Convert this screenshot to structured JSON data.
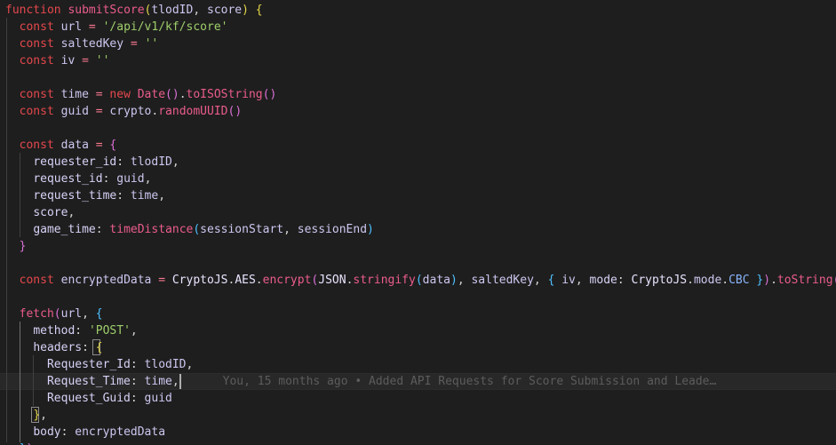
{
  "editor": {
    "blame_text": "You, 15 months ago • Added API Requests for Score Submission and Leade…",
    "lines": [
      [
        [
          "kw",
          "function "
        ],
        [
          "fn",
          "submitScore"
        ],
        [
          "b1",
          "("
        ],
        [
          "var",
          "tlodID"
        ],
        [
          "p",
          ", "
        ],
        [
          "var",
          "score"
        ],
        [
          "b1",
          ")"
        ],
        [
          "p",
          " "
        ],
        [
          "b1",
          "{"
        ]
      ],
      [
        [
          "p",
          "  "
        ],
        [
          "kw",
          "const "
        ],
        [
          "var",
          "url"
        ],
        [
          "op",
          " = "
        ],
        [
          "str",
          "'/api/v1/kf/score'"
        ]
      ],
      [
        [
          "p",
          "  "
        ],
        [
          "kw",
          "const "
        ],
        [
          "var",
          "saltedKey"
        ],
        [
          "op",
          " = "
        ],
        [
          "str",
          "''"
        ]
      ],
      [
        [
          "p",
          "  "
        ],
        [
          "kw",
          "const "
        ],
        [
          "var",
          "iv"
        ],
        [
          "op",
          " = "
        ],
        [
          "str",
          "''"
        ]
      ],
      [],
      [
        [
          "p",
          "  "
        ],
        [
          "kw",
          "const "
        ],
        [
          "var",
          "time"
        ],
        [
          "op",
          " = "
        ],
        [
          "kw",
          "new "
        ],
        [
          "fn",
          "Date"
        ],
        [
          "b2",
          "()"
        ],
        [
          "p",
          "."
        ],
        [
          "fn",
          "toISOString"
        ],
        [
          "b2",
          "()"
        ]
      ],
      [
        [
          "p",
          "  "
        ],
        [
          "kw",
          "const "
        ],
        [
          "var",
          "guid"
        ],
        [
          "op",
          " = "
        ],
        [
          "var",
          "crypto"
        ],
        [
          "p",
          "."
        ],
        [
          "fn",
          "randomUUID"
        ],
        [
          "b2",
          "()"
        ]
      ],
      [],
      [
        [
          "p",
          "  "
        ],
        [
          "kw",
          "const "
        ],
        [
          "var",
          "data"
        ],
        [
          "op",
          " = "
        ],
        [
          "b2",
          "{"
        ]
      ],
      [
        [
          "p",
          "    "
        ],
        [
          "prop",
          "requester_id"
        ],
        [
          "p",
          ": "
        ],
        [
          "var",
          "tlodID"
        ],
        [
          "p",
          ","
        ]
      ],
      [
        [
          "p",
          "    "
        ],
        [
          "prop",
          "request_id"
        ],
        [
          "p",
          ": "
        ],
        [
          "var",
          "guid"
        ],
        [
          "p",
          ","
        ]
      ],
      [
        [
          "p",
          "    "
        ],
        [
          "prop",
          "request_time"
        ],
        [
          "p",
          ": "
        ],
        [
          "var",
          "time"
        ],
        [
          "p",
          ","
        ]
      ],
      [
        [
          "p",
          "    "
        ],
        [
          "prop",
          "score"
        ],
        [
          "p",
          ","
        ]
      ],
      [
        [
          "p",
          "    "
        ],
        [
          "prop",
          "game_time"
        ],
        [
          "p",
          ": "
        ],
        [
          "fn",
          "timeDistance"
        ],
        [
          "b3",
          "("
        ],
        [
          "var",
          "sessionStart"
        ],
        [
          "p",
          ", "
        ],
        [
          "var",
          "sessionEnd"
        ],
        [
          "b3",
          ")"
        ]
      ],
      [
        [
          "p",
          "  "
        ],
        [
          "b2",
          "}"
        ]
      ],
      [],
      [
        [
          "p",
          "  "
        ],
        [
          "kw",
          "const "
        ],
        [
          "var",
          "encryptedData"
        ],
        [
          "op",
          " = "
        ],
        [
          "cls",
          "CryptoJS"
        ],
        [
          "p",
          "."
        ],
        [
          "cls",
          "AES"
        ],
        [
          "p",
          "."
        ],
        [
          "fn",
          "encrypt"
        ],
        [
          "b2",
          "("
        ],
        [
          "cls",
          "JSON"
        ],
        [
          "p",
          "."
        ],
        [
          "fn",
          "stringify"
        ],
        [
          "b3",
          "("
        ],
        [
          "var",
          "data"
        ],
        [
          "b3",
          ")"
        ],
        [
          "p",
          ", "
        ],
        [
          "var",
          "saltedKey"
        ],
        [
          "p",
          ", "
        ],
        [
          "b3",
          "{"
        ],
        [
          "p",
          " "
        ],
        [
          "var",
          "iv"
        ],
        [
          "p",
          ", "
        ],
        [
          "prop",
          "mode"
        ],
        [
          "p",
          ": "
        ],
        [
          "cls",
          "CryptoJS"
        ],
        [
          "p",
          "."
        ],
        [
          "var",
          "mode"
        ],
        [
          "p",
          "."
        ],
        [
          "mem",
          "CBC"
        ],
        [
          "p",
          " "
        ],
        [
          "b3",
          "}"
        ],
        [
          "b2",
          ")"
        ],
        [
          "p",
          "."
        ],
        [
          "fn",
          "toString"
        ],
        [
          "b2",
          "()"
        ]
      ],
      [],
      [
        [
          "p",
          "  "
        ],
        [
          "fn",
          "fetch"
        ],
        [
          "b2",
          "("
        ],
        [
          "var",
          "url"
        ],
        [
          "p",
          ", "
        ],
        [
          "b3",
          "{"
        ]
      ],
      [
        [
          "p",
          "    "
        ],
        [
          "prop",
          "method"
        ],
        [
          "p",
          ": "
        ],
        [
          "str",
          "'POST'"
        ],
        [
          "p",
          ","
        ]
      ],
      [
        [
          "p",
          "    "
        ],
        [
          "prop",
          "headers"
        ],
        [
          "p",
          ": "
        ],
        [
          "b1",
          "{"
        ]
      ],
      [
        [
          "p",
          "      "
        ],
        [
          "prop",
          "Requester_Id"
        ],
        [
          "p",
          ": "
        ],
        [
          "var",
          "tlodID"
        ],
        [
          "p",
          ","
        ]
      ],
      [
        [
          "p",
          "      "
        ],
        [
          "prop",
          "Request_Time"
        ],
        [
          "p",
          ": "
        ],
        [
          "var",
          "time"
        ],
        [
          "p",
          ","
        ]
      ],
      [
        [
          "p",
          "      "
        ],
        [
          "prop",
          "Request_Guid"
        ],
        [
          "p",
          ": "
        ],
        [
          "var",
          "guid"
        ]
      ],
      [
        [
          "p",
          "    "
        ],
        [
          "b1",
          "}"
        ],
        [
          "p",
          ","
        ]
      ],
      [
        [
          "p",
          "    "
        ],
        [
          "prop",
          "body"
        ],
        [
          "p",
          ": "
        ],
        [
          "var",
          "encryptedData"
        ]
      ],
      [
        [
          "p",
          "  "
        ],
        [
          "b3",
          "}"
        ],
        [
          "b2",
          ")"
        ]
      ]
    ]
  }
}
